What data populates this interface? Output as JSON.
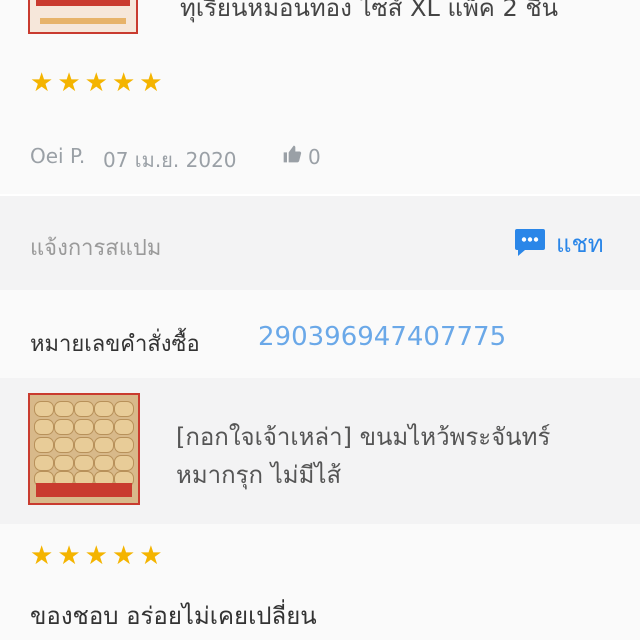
{
  "top_product": {
    "name": "ทุเรียนหมอนทอง ไซส์ XL แพ็ค 2 ชิ้น"
  },
  "review1": {
    "rating": 5,
    "reviewer": "Oei P.",
    "date": "07 เม.ย. 2020",
    "likes": "0"
  },
  "report": {
    "label": "แจ้งการสแปม",
    "chat_label": "แชท"
  },
  "order": {
    "label": "หมายเลขคำสั่งซื้อ",
    "number": "290396947407775"
  },
  "product2": {
    "name": "[กอกใจเจ้าเหล่า] ขนมไหว้พระจันทร์ หมากรุก ไม่มีไส้"
  },
  "review2": {
    "rating": 5,
    "text": "ของชอบ อร่อยไม่เคยเปลี่ยน"
  },
  "colors": {
    "star": "#f4b400",
    "chat": "#2a86e8",
    "order_number": "#6aa8e8"
  }
}
